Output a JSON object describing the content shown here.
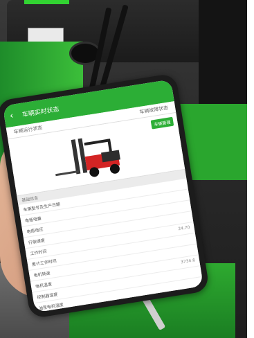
{
  "app": {
    "title": "车辆实时状态",
    "tabs": [
      "车辆运行状态",
      "车辆故障状态"
    ],
    "action_button": "车辆管理"
  },
  "section_label": "基础信息",
  "rows": [
    {
      "label": "车辆型号及生产日期",
      "value": ""
    },
    {
      "label": "电瓶电量",
      "value": ""
    },
    {
      "label": "电瓶电压",
      "value": ""
    },
    {
      "label": "行驶速度",
      "value": ""
    },
    {
      "label": "工作时间",
      "value": "24.70"
    },
    {
      "label": "累计工作时间",
      "value": ""
    },
    {
      "label": "电机转速",
      "value": ""
    },
    {
      "label": "电机温度",
      "value": "3734.6"
    },
    {
      "label": "控制器温度",
      "value": ""
    },
    {
      "label": "油泵电机温度",
      "value": ""
    }
  ]
}
